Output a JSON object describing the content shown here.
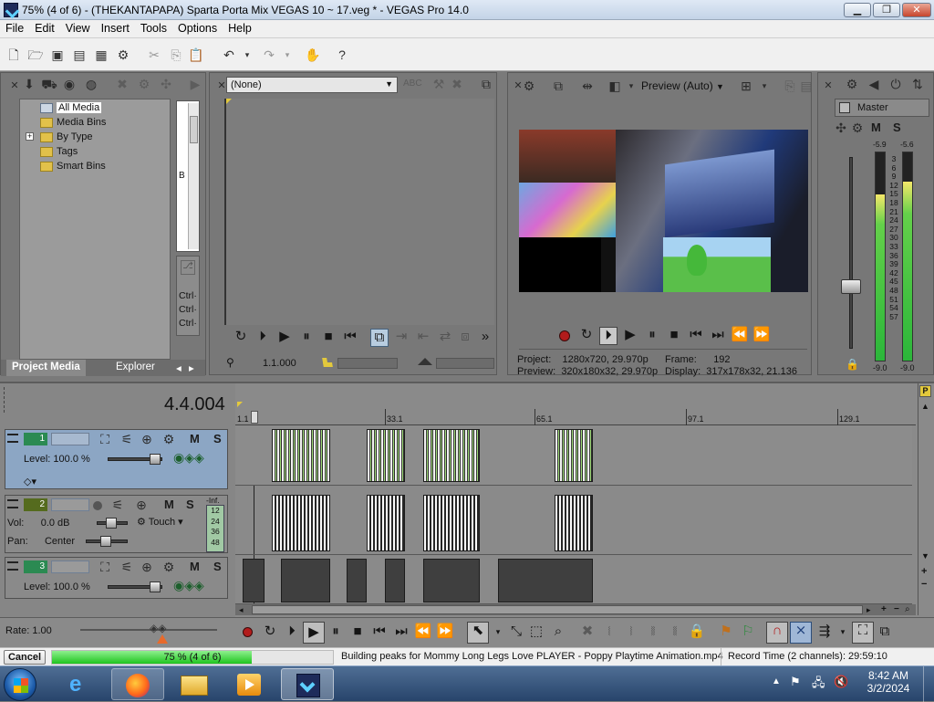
{
  "window": {
    "title": "75% (4 of 6) - (THEKANTAPAPA) Sparta Porta Mix VEGAS 10 ~ 17.veg * - VEGAS Pro 14.0",
    "min": "▁",
    "max": "❐",
    "close": "✕"
  },
  "menu": [
    "File",
    "Edit",
    "View",
    "Insert",
    "Tools",
    "Options",
    "Help"
  ],
  "project_media": {
    "tree": [
      "All Media",
      "Media Bins",
      "By Type",
      "Tags",
      "Smart Bins"
    ],
    "expander": "+",
    "side_letter": "B",
    "ctrl_lines": [
      "Ctrl·",
      "Ctrl·",
      "Ctrl·"
    ],
    "tabs": [
      "Project Media",
      "Explorer"
    ],
    "tab_arrows": [
      "◂",
      "▸"
    ]
  },
  "trimmer": {
    "select_value": "(None)",
    "timecode": "1.1.000"
  },
  "preview": {
    "mode": "Preview (Auto)",
    "info": {
      "project_label": "Project:",
      "project_value": "1280x720, 29.970p",
      "preview_label": "Preview:",
      "preview_value": "320x180x32, 29.970p",
      "frame_label": "Frame:",
      "frame_value": "192",
      "display_label": "Display:",
      "display_value": "317x178x32, 21.136"
    }
  },
  "master": {
    "label": "Master",
    "m": "M",
    "s": "S",
    "peak_left": "-5.9",
    "peak_right": "-5.6",
    "scale": [
      "3",
      "6",
      "9",
      "12",
      "15",
      "18",
      "21",
      "24",
      "27",
      "30",
      "33",
      "36",
      "39",
      "42",
      "45",
      "48",
      "51",
      "54",
      "57"
    ],
    "bottom_left": "-9.0",
    "bottom_right": "-9.0",
    "level_left": 0.8,
    "level_right": 0.86
  },
  "timeline": {
    "position": "4.4.004",
    "ruler": [
      "1.1",
      "33.1",
      "65.1",
      "97.1",
      "129.1"
    ],
    "tracks": [
      {
        "num": "1",
        "level_label": "Level:",
        "level_value": "100.0 %",
        "m": "M",
        "s": "S"
      },
      {
        "num": "2",
        "vol_label": "Vol:",
        "vol_value": "0.0 dB",
        "pan_label": "Pan:",
        "pan_value": "Center",
        "touch": "Touch",
        "m": "M",
        "s": "S",
        "inf": "-Inf.",
        "meter_ticks": [
          "12",
          "24",
          "36",
          "48"
        ]
      },
      {
        "num": "3",
        "level_label": "Level:",
        "level_value": "100.0 %",
        "m": "M",
        "s": "S"
      }
    ],
    "rate_label": "Rate: 1.00"
  },
  "status": {
    "cancel": "Cancel",
    "progress_text": "75 % (4 of 6)",
    "progress": 0.75,
    "message": "Building peaks for Mommy Long Legs Love PLAYER - Poppy Playtime Animation.mp4",
    "record_time": "Record Time (2 channels): 29:59:10"
  },
  "taskbar": {
    "time": "8:42 AM",
    "date": "3/2/2024"
  }
}
